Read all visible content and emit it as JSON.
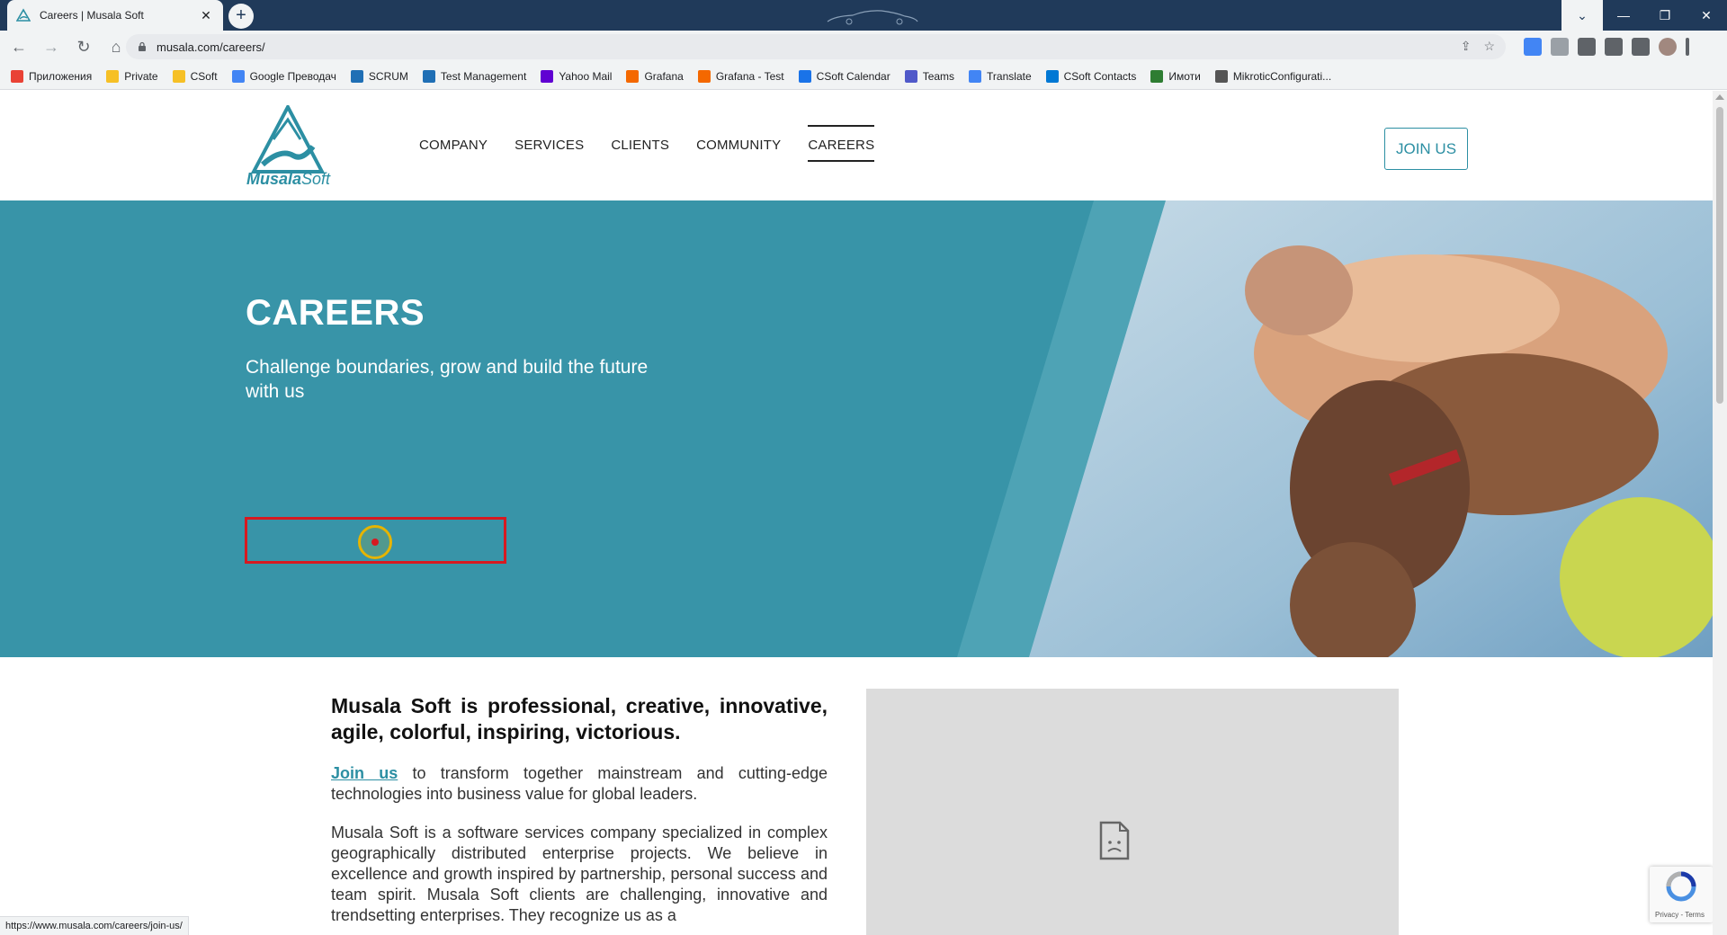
{
  "browser": {
    "tab_title": "Careers | Musala Soft",
    "tab_close": "✕",
    "new_tab": "+",
    "url": "musala.com/careers/",
    "window_controls": {
      "dropdown": "⌄",
      "minimize": "—",
      "restore": "❐",
      "close": "✕"
    },
    "nav": {
      "back": "←",
      "forward": "→",
      "reload": "↻",
      "home": "⌂"
    },
    "omnibox_icons": {
      "share": "⇪",
      "star": "☆"
    }
  },
  "bookmarks": [
    {
      "label": "Приложения",
      "color": "#e94235"
    },
    {
      "label": "Private",
      "color": "#f6c026"
    },
    {
      "label": "CSoft",
      "color": "#f6c026"
    },
    {
      "label": "Google Преводач",
      "color": "#4285f4"
    },
    {
      "label": "SCRUM",
      "color": "#1f6fb5"
    },
    {
      "label": "Test Management",
      "color": "#1f6fb5"
    },
    {
      "label": "Yahoo Mail",
      "color": "#6001d2"
    },
    {
      "label": "Grafana",
      "color": "#f46800"
    },
    {
      "label": "Grafana - Test",
      "color": "#f46800"
    },
    {
      "label": "CSoft Calendar",
      "color": "#1a73e8"
    },
    {
      "label": "Teams",
      "color": "#5059c9"
    },
    {
      "label": "Translate",
      "color": "#4285f4"
    },
    {
      "label": "CSoft Contacts",
      "color": "#0078d4"
    },
    {
      "label": "Имоти",
      "color": "#2e7d32"
    },
    {
      "label": "MikroticConfigurati...",
      "color": "#555555"
    }
  ],
  "site": {
    "logo_main": "Musala",
    "logo_sub": "Soft",
    "nav": [
      "COMPANY",
      "SERVICES",
      "CLIENTS",
      "COMMUNITY",
      "CAREERS"
    ],
    "active_nav": "CAREERS",
    "join_button": "JOIN US",
    "brand_color": "#3894a8"
  },
  "hero": {
    "title": "CAREERS",
    "tagline": "Challenge boundaries, grow and build the future with us"
  },
  "intro": {
    "heading": "Musala Soft is professional, creative, innovative, agile, colorful, inspiring, victorious.",
    "join_link": "Join us",
    "join_text": " to transform together mainstream and cutting-edge technologies into business value for global leaders.",
    "about": "Musala Soft is a software services company specialized in complex geographically distributed enterprise projects. We believe in excellence and growth inspired by partnership, personal success and team spirit. Musala Soft clients are challenging, innovative and trendsetting enterprises. They recognize us as a"
  },
  "recaptcha": {
    "label": "Privacy - Terms"
  },
  "statusbar": {
    "url": "https://www.musala.com/careers/join-us/"
  }
}
